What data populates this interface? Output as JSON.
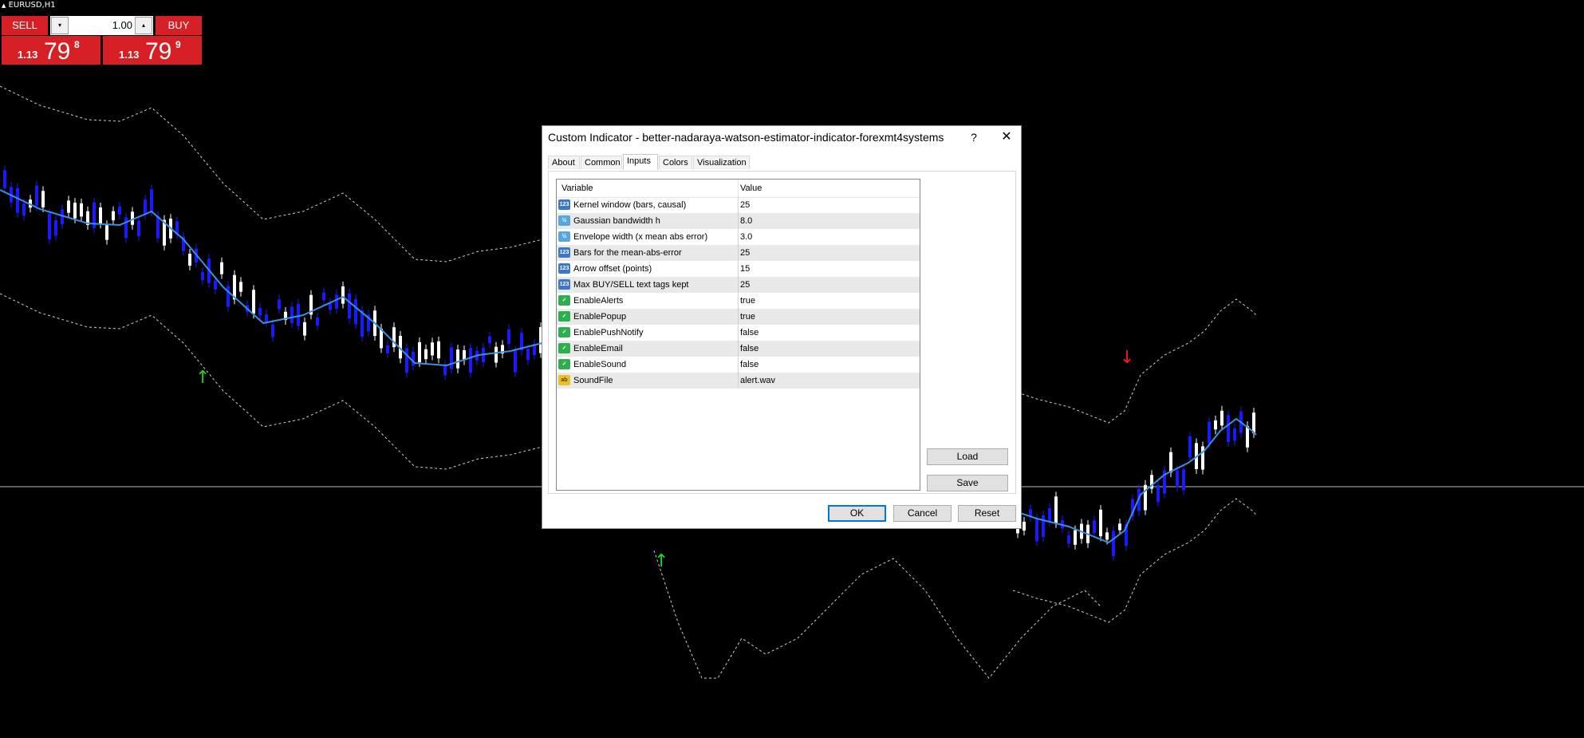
{
  "chart": {
    "symbol_label": "EURUSD,H1"
  },
  "trade_panel": {
    "sell_label": "SELL",
    "buy_label": "BUY",
    "lot_value": "1.00",
    "lot_down_glyph": "▾",
    "lot_up_glyph": "▴",
    "bid": {
      "big": "1.13",
      "pips": "79",
      "frac": "8"
    },
    "ask": {
      "big": "1.13",
      "pips": "79",
      "frac": "9"
    }
  },
  "dialog": {
    "title": "Custom Indicator - better-nadaraya-watson-estimator-indicator-forexmt4systems",
    "help_glyph": "?",
    "close_glyph": "✕",
    "tabs": [
      {
        "label": "About"
      },
      {
        "label": "Common"
      },
      {
        "label": "Inputs"
      },
      {
        "label": "Colors"
      },
      {
        "label": "Visualization"
      }
    ],
    "active_tab": "Inputs",
    "grid": {
      "col_variable": "Variable",
      "col_value": "Value",
      "rows": [
        {
          "icon": "int",
          "icon_text": "123",
          "name": "Kernel window (bars, causal)",
          "value": "25"
        },
        {
          "icon": "dbl",
          "icon_text": "½",
          "name": "Gaussian bandwidth h",
          "value": "8.0"
        },
        {
          "icon": "dbl",
          "icon_text": "½",
          "name": "Envelope width (x mean abs error)",
          "value": "3.0"
        },
        {
          "icon": "int",
          "icon_text": "123",
          "name": "Bars for the mean-abs-error",
          "value": "25"
        },
        {
          "icon": "int",
          "icon_text": "123",
          "name": "Arrow offset (points)",
          "value": "15"
        },
        {
          "icon": "int",
          "icon_text": "123",
          "name": "Max BUY/SELL text tags kept",
          "value": "25"
        },
        {
          "icon": "bool",
          "icon_text": "✓",
          "name": "EnableAlerts",
          "value": "true"
        },
        {
          "icon": "bool",
          "icon_text": "✓",
          "name": "EnablePopup",
          "value": "true"
        },
        {
          "icon": "bool",
          "icon_text": "✓",
          "name": "EnablePushNotify",
          "value": "false"
        },
        {
          "icon": "bool",
          "icon_text": "✓",
          "name": "EnableEmail",
          "value": "false"
        },
        {
          "icon": "bool",
          "icon_text": "✓",
          "name": "EnableSound",
          "value": "false"
        },
        {
          "icon": "str",
          "icon_text": "ab",
          "name": "SoundFile",
          "value": "alert.wav"
        }
      ]
    },
    "buttons": {
      "load": "Load",
      "save": "Save",
      "ok": "OK",
      "cancel": "Cancel",
      "reset": "Reset"
    }
  },
  "colors": {
    "background": "#000000",
    "bull_candle": "#ffffff",
    "bear_candle": "#1a1aff",
    "estimator_line": "#3b8fe0",
    "envelope": "#cfcfcf",
    "buy_arrow": "#1ed61e",
    "sell_arrow": "#ff1a1a",
    "trade_red": "#d62026"
  },
  "icons": {
    "buy_arrow": "buy-arrow-icon",
    "sell_arrow": "sell-arrow-icon"
  }
}
